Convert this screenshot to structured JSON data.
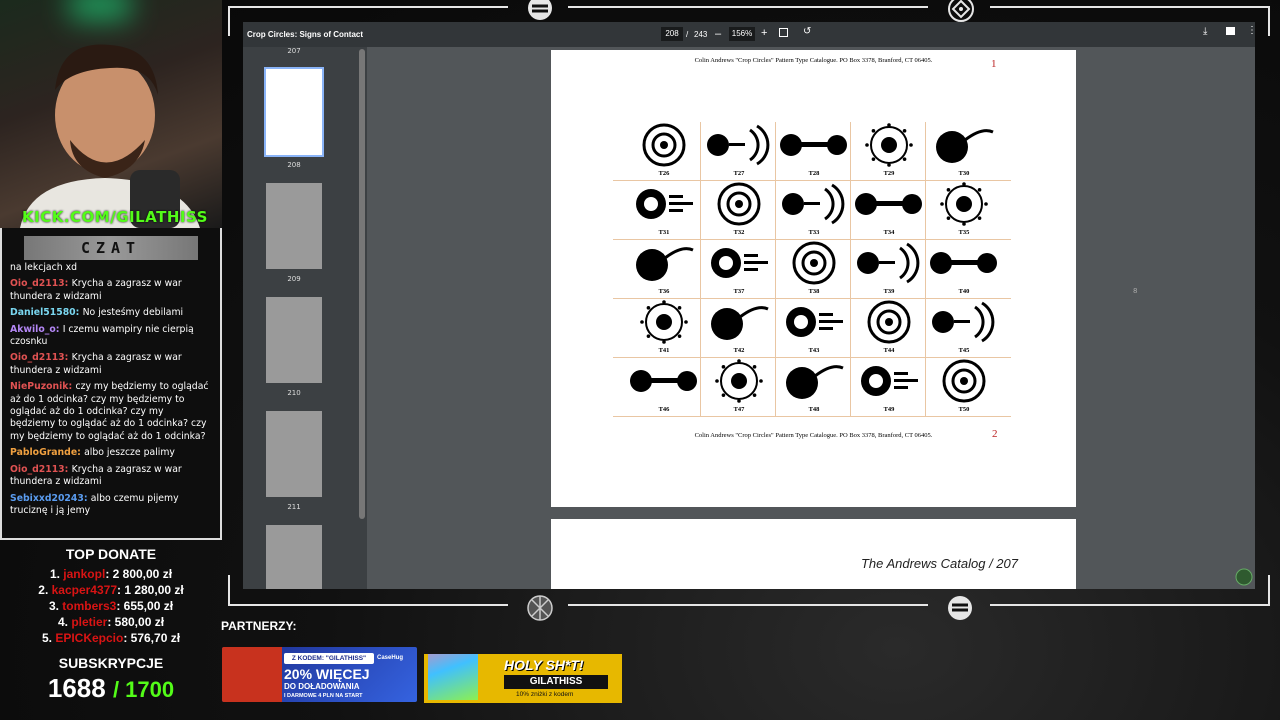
{
  "stream": {
    "kick_label": "KICK.COM/GILATHISS",
    "chat_title": "CZAT",
    "chat": [
      {
        "user": "",
        "text": "na lekcjach xd",
        "color": "#ffffff"
      },
      {
        "user": "Oio_d2113:",
        "text": "Krycha a zagrasz w war thundera z widzami",
        "color": "#e05252"
      },
      {
        "user": "Daniel51580:",
        "text": "No jesteśmy debilami",
        "color": "#7ad7f0"
      },
      {
        "user": "Akwilo_o:",
        "text": "I czemu wampiry nie cierpią czosnku",
        "color": "#b487f5"
      },
      {
        "user": "Oio_d2113:",
        "text": "Krycha a zagrasz w war thundera z widzami",
        "color": "#e05252"
      },
      {
        "user": "NiePuzonik:",
        "text": "czy my będziemy to oglądać aż do 1 odcinka? czy my będziemy to oglądać aż do 1 odcinka? czy my będziemy to oglądać aż do 1 odcinka? czy my będziemy to oglądać aż do 1 odcinka?",
        "color": "#e05252"
      },
      {
        "user": "PabloGrande:",
        "text": "albo jeszcze palimy",
        "color": "#f0a040"
      },
      {
        "user": "Oio_d2113:",
        "text": "Krycha a zagrasz w war thundera z widzami",
        "color": "#e05252"
      },
      {
        "user": "Sebixxd20243:",
        "text": "albo czemu pijemy truciznę i ją jemy",
        "color": "#5a9cf0"
      }
    ],
    "top_donate_title": "TOP DONATE",
    "donations": [
      {
        "rank": "1.",
        "name": "jankopl",
        "amount": ": 2 800,00 zł"
      },
      {
        "rank": "2.",
        "name": "kacper4377",
        "amount": ": 1 280,00 zł"
      },
      {
        "rank": "3.",
        "name": "tombers3",
        "amount": ": 655,00 zł"
      },
      {
        "rank": "4.",
        "name": "pletier",
        "amount": ": 580,00 zł"
      },
      {
        "rank": "5.",
        "name": "EPICKepcio",
        "amount": ": 576,70 zł"
      }
    ],
    "subs_title": "SUBSKRYPCJE",
    "subs_current": "1688",
    "subs_goal": "/ 1700",
    "partners_label": "PARTNERZY:",
    "banner1": {
      "code_line": "Z KODEM: \"GILATHISS\"",
      "headline": "20% WIĘCEJ",
      "sub": "DO DOŁADOWANIA",
      "small": "I DARMOWE 4 PLN NA START",
      "brand": "CaseHug"
    },
    "banner2": {
      "headline": "HOLY SH*T!",
      "code": "GILATHISS",
      "small": "10% zniżki z kodem"
    }
  },
  "pdf": {
    "title": "Crop Circles: Signs of Contact",
    "page_current": "208",
    "page_total": "243",
    "zoom": "156%",
    "page_above_label": "207",
    "thumbnails": [
      "208",
      "209",
      "210",
      "211"
    ],
    "header_text": "Colin Andrews \"Crop Circles\" Pattern Type Catalogue. PO Box 3378, Branford, CT 06405.",
    "header_num": "1",
    "footer_text": "Colin Andrews \"Crop Circles\" Pattern Type Catalogue. PO Box 3378, Branford, CT 06405.",
    "footer_num": "2",
    "side_marker": "8",
    "next_page_header": "The Andrews Catalog / 207",
    "cells": [
      "T26",
      "T27",
      "T28",
      "T29",
      "T30",
      "T31",
      "T32",
      "T33",
      "T34",
      "T35",
      "T36",
      "T37",
      "T38",
      "T39",
      "T40",
      "T41",
      "T42",
      "T43",
      "T44",
      "T45",
      "T46",
      "T47",
      "T48",
      "T49",
      "T50"
    ]
  },
  "colors": {
    "kick_green": "#53fc18",
    "subs_green": "#53fc18",
    "donor_red": "#d91414",
    "pdf_toolbar": "#323639",
    "pdf_bg": "#525659"
  }
}
